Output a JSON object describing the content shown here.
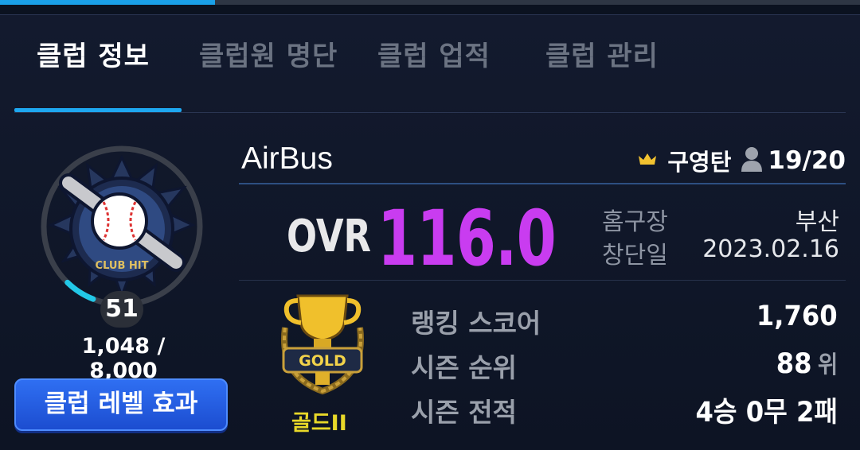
{
  "tabs": [
    {
      "label": "클럽 정보",
      "active": true
    },
    {
      "label": "클럽원 명단",
      "active": false
    },
    {
      "label": "클럽 업적",
      "active": false
    },
    {
      "label": "클럽 관리",
      "active": false
    }
  ],
  "club": {
    "emblem_text": "CLUB HIT",
    "level": "51",
    "exp": "1,048 / 8,000",
    "exp_progress": 0.131,
    "level_button": "클럽 레벨 효과",
    "name": "AirBus",
    "leader_icon": "crown-icon",
    "leader": "구영탄",
    "member_icon": "person-icon",
    "members": "19/20",
    "ovr_label": "OVR",
    "ovr_value": "116.0",
    "home_label": "홈구장",
    "home_value": "부산",
    "founded_label": "창단일",
    "founded_value": "2023.02.16"
  },
  "tier": {
    "icon": "gold-trophy-icon",
    "badge_text": "GOLD",
    "label": "골드II"
  },
  "stats": [
    {
      "label": "랭킹 스코어",
      "value": "1,760",
      "unit": ""
    },
    {
      "label": "시즌 순위",
      "value": "88",
      "unit": "위"
    },
    {
      "label": "시즌 전적",
      "value": "4승 0무 2패",
      "unit": ""
    }
  ],
  "colors": {
    "accent": "#1ea7f0",
    "ovr": "#c93cf0",
    "tier": "#e8d829",
    "button": "#2f6ff2"
  }
}
